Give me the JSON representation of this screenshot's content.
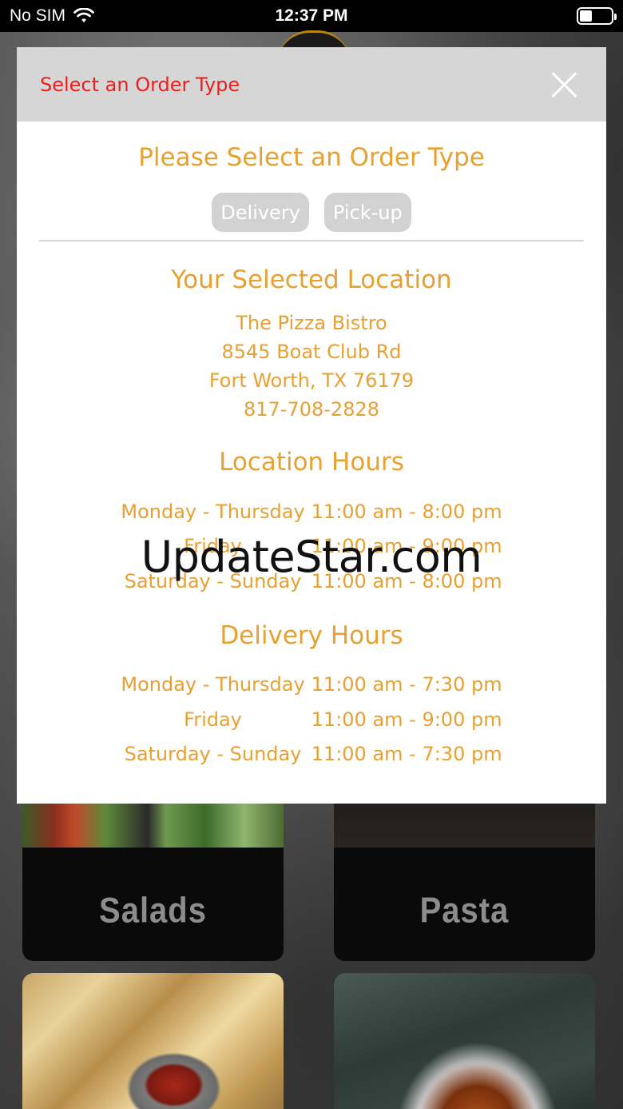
{
  "status_bar": {
    "carrier": "No SIM",
    "time": "12:37 PM",
    "battery_level": 0.4
  },
  "modal": {
    "header_title": "Select an Order Type",
    "prompt_title": "Please Select an Order Type",
    "buttons": {
      "delivery": "Delivery",
      "pickup": "Pick-up"
    },
    "location": {
      "title": "Your Selected Location",
      "name": "The Pizza Bistro",
      "street": "8545 Boat Club Rd",
      "city": "Fort Worth, TX 76179",
      "phone": "817-708-2828"
    },
    "location_hours": {
      "title": "Location Hours",
      "rows": [
        {
          "day": "Monday - Thursday",
          "time": "11:00 am - 8:00 pm"
        },
        {
          "day": "Friday",
          "time": "11:00 am - 9:00 pm"
        },
        {
          "day": "Saturday - Sunday",
          "time": "11:00 am - 8:00 pm"
        }
      ]
    },
    "delivery_hours": {
      "title": "Delivery Hours",
      "rows": [
        {
          "day": "Monday - Thursday",
          "time": "11:00 am - 7:30 pm"
        },
        {
          "day": "Friday",
          "time": "11:00 am - 9:00 pm"
        },
        {
          "day": "Saturday - Sunday",
          "time": "11:00 am - 7:30 pm"
        }
      ]
    }
  },
  "categories": [
    {
      "label": "Salads"
    },
    {
      "label": "Pasta"
    }
  ],
  "watermark": "UpdateStar.com",
  "colors": {
    "accent_orange": "#e8a030",
    "header_red": "#ee1c1c",
    "header_bg": "#d6d6d6",
    "button_bg": "#d2d2d2"
  }
}
